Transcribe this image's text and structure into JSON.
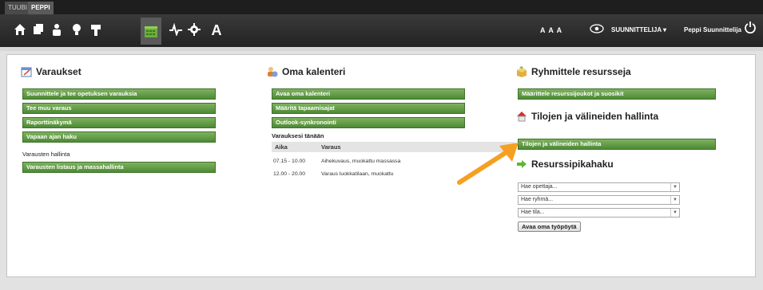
{
  "top_tabs": [
    "TUUBI",
    "PEPPI"
  ],
  "nav_icons": [
    "home-icon",
    "cards-icon",
    "person-icon",
    "lightbulb-icon",
    "flag-icon",
    "calendar-icon",
    "activity-icon",
    "gear-icon",
    "font-icon"
  ],
  "nav_font_letter": "A",
  "text_size": "A A A",
  "role_label": "SUUNNITTELIJA ▾",
  "user_name": "Peppi Suunnittelija",
  "colors": {
    "green_button": "#5a9a3e",
    "arrow": "#f5a023"
  },
  "varaukset": {
    "title": "Varaukset",
    "buttons": [
      "Suunnittele ja tee opetuksen varauksia",
      "Tee muu varaus",
      "Raporttinäkymä",
      "Vapaan ajan haku"
    ],
    "sub_label": "Varausten hallinta",
    "sub_button": "Varausten listaus ja massahallinta"
  },
  "kalenteri": {
    "title": "Oma kalenteri",
    "buttons": [
      "Avaa oma kalenteri",
      "Määritä tapaamisajat",
      "Outlook-synkronointi"
    ],
    "today_label": "Varauksesi tänään",
    "columns": [
      "Aika",
      "Varaus"
    ],
    "rows": [
      {
        "time": "07.15 - 10.00",
        "desc": "Aihekuvaus, muokattu massassa"
      },
      {
        "time": "12.00 - 20.00",
        "desc": "Varaus luokkatilaan, muokattu"
      }
    ]
  },
  "ryhmittele": {
    "title": "Ryhmittele resursseja",
    "button": "Määrittele resurssijoukot ja suosikit"
  },
  "tilojen": {
    "title": "Tilojen ja välineiden hallinta",
    "button": "Tilojen ja välineiden hallinta"
  },
  "pikahaku": {
    "title": "Resurssipikahaku",
    "selects": [
      "Hae opettaja...",
      "Hae ryhmä...",
      "Hae tila..."
    ],
    "open_button": "Avaa oma työpöytä"
  }
}
